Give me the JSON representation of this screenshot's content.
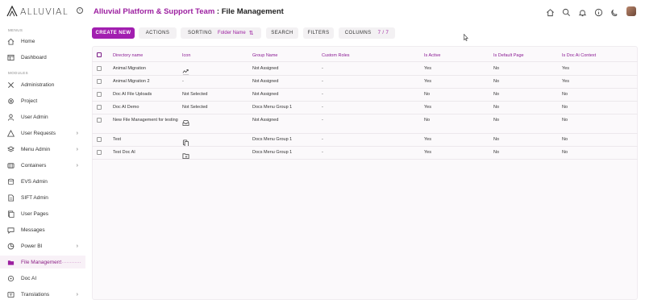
{
  "brand": {
    "name": "ALLUVIAL"
  },
  "sidebar": {
    "menus_label": "MENUS",
    "modules_label": "MODULES",
    "top_items": [
      {
        "label": "Home",
        "icon": "home-icon"
      },
      {
        "label": "Dashboard",
        "icon": "dashboard-icon"
      }
    ],
    "items": [
      {
        "label": "Administration",
        "icon": "tools-icon",
        "chevron": false
      },
      {
        "label": "Project",
        "icon": "gear-icon",
        "chevron": false
      },
      {
        "label": "User Admin",
        "icon": "user-icon",
        "chevron": false
      },
      {
        "label": "User Requests",
        "icon": "warning-icon",
        "chevron": true
      },
      {
        "label": "Menu Admin",
        "icon": "layers-icon",
        "chevron": true
      },
      {
        "label": "Containers",
        "icon": "container-icon",
        "chevron": true
      },
      {
        "label": "EVS Admin",
        "icon": "database-icon",
        "chevron": false
      },
      {
        "label": "SIFT Admin",
        "icon": "document-icon",
        "chevron": false
      },
      {
        "label": "User Pages",
        "icon": "pages-icon",
        "chevron": false
      },
      {
        "label": "Messages",
        "icon": "message-icon",
        "chevron": false
      },
      {
        "label": "Power BI",
        "icon": "powerbi-icon",
        "chevron": true
      },
      {
        "label": "File Management",
        "icon": "folder-icon",
        "chevron": false,
        "active": true
      },
      {
        "label": "Doc AI",
        "icon": "docai-icon",
        "chevron": false
      },
      {
        "label": "Translations",
        "icon": "translate-icon",
        "chevron": true
      }
    ]
  },
  "header": {
    "org": "Alluvial Platform & Support Team",
    "separator": " : ",
    "page": "File Management"
  },
  "toolbar": {
    "create_label": "CREATE NEW",
    "actions_label": "ACTIONS",
    "sorting_label": "SORTING",
    "sorting_value": "Folder Name",
    "search_label": "SEARCH",
    "filters_label": "FILTERS",
    "columns_label": "COLUMNS",
    "columns_count": "7 / 7"
  },
  "table": {
    "columns": [
      "Directory name",
      "Icon",
      "Group Name",
      "Custom Roles",
      "Is Active",
      "Is Default Page",
      "Is Doc Ai Context"
    ],
    "rows": [
      {
        "name": "Animal Migration",
        "icon_text": "",
        "icon": "migration-icon",
        "group": "Not Assigned",
        "roles": "-",
        "active": "Yes",
        "default": "No",
        "docai": "Yes"
      },
      {
        "name": "Animal Migration 2",
        "icon_text": "-",
        "icon": "",
        "group": "Not Assigned",
        "roles": "-",
        "active": "Yes",
        "default": "No",
        "docai": "Yes"
      },
      {
        "name": "Doc AI File Uploads",
        "icon_text": "Not Selected",
        "icon": "",
        "group": "Not Assigned",
        "roles": "-",
        "active": "No",
        "default": "No",
        "docai": "No"
      },
      {
        "name": "Doc AI Demo",
        "icon_text": "Not Selected",
        "icon": "",
        "group": "Docs Menu Group 1",
        "roles": "-",
        "active": "Yes",
        "default": "No",
        "docai": "No"
      },
      {
        "name": "New File Management for testing",
        "icon_text": "",
        "icon": "inbox-icon",
        "group": "Not Assigned",
        "roles": "-",
        "active": "No",
        "default": "No",
        "docai": "No"
      },
      {
        "name": "Test",
        "icon_text": "",
        "icon": "copy-icon",
        "group": "Docs Menu Group 1",
        "roles": "-",
        "active": "Yes",
        "default": "No",
        "docai": "No"
      },
      {
        "name": "Test Doc AI",
        "icon_text": "",
        "icon": "folder-icon",
        "group": "Docs Menu Group 1",
        "roles": "-",
        "active": "Yes",
        "default": "No",
        "docai": "No"
      }
    ]
  },
  "colors": {
    "accent": "#a21fb0",
    "header_text": "#8a1a94"
  }
}
